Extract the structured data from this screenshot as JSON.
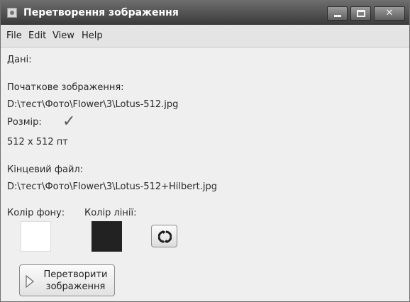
{
  "window": {
    "title": "Перетворення зображення"
  },
  "menu": [
    "File",
    "Edit",
    "View",
    "Help"
  ],
  "content": {
    "data_label": "Дані:",
    "source_label": "Початкове зображення:",
    "source_path": "D:\\тест\\Фото\\Flower\\3\\Lotus-512.jpg",
    "size_label": "Розмір:",
    "size_value": "512 x 512 пт",
    "target_label": "Кінцевий файл:",
    "target_path": "D:\\тест\\Фото\\Flower\\3\\Lotus-512+Hilbert.jpg",
    "bg_color_label": "Колір фону:",
    "line_color_label": "Колір лінії:",
    "convert_button": [
      "Перетворити",
      "зображення"
    ]
  },
  "colors": {
    "background_swatch": "#ffffff",
    "line_swatch": "#222222"
  },
  "icons": {
    "app": "app-icon",
    "check": "checkmark-icon",
    "swap": "swap-colors-icon",
    "convert": "play-icon"
  }
}
